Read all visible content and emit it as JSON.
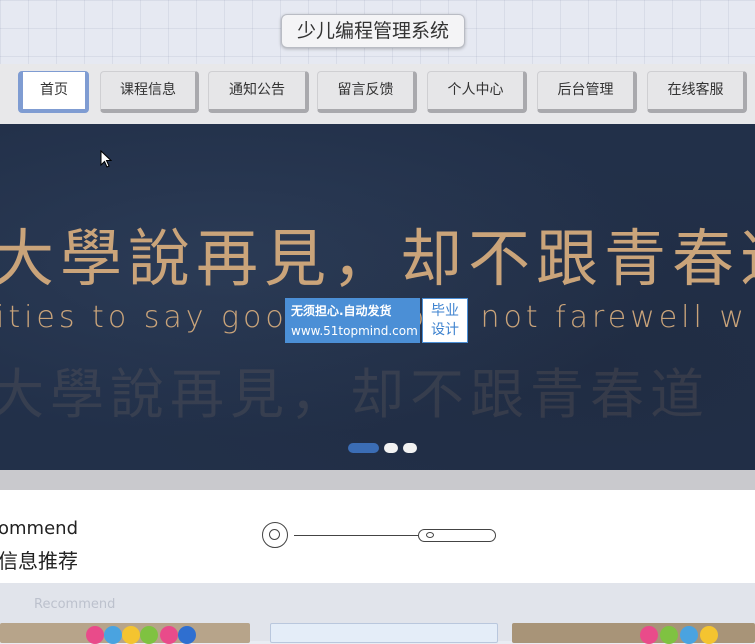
{
  "header": {
    "title": "少儿编程管理系统"
  },
  "nav": {
    "items": [
      {
        "label": "首页",
        "active": true
      },
      {
        "label": "课程信息",
        "active": false
      },
      {
        "label": "通知公告",
        "active": false
      },
      {
        "label": "留言反馈",
        "active": false
      },
      {
        "label": "个人中心",
        "active": false
      },
      {
        "label": "后台管理",
        "active": false
      },
      {
        "label": "在线客服",
        "active": false
      }
    ]
  },
  "banner": {
    "line_cn": "大學說再見，却不跟青春道",
    "line_en": "ities to say goodbye, but not farewell w",
    "carousel_dots": 3,
    "active_dot": 0
  },
  "ad": {
    "line1": "无须担心.自动发货",
    "line2": "www.51topmind.com",
    "badge_line1": "毕业",
    "badge_line2": "设计"
  },
  "recommend": {
    "title_en": "ommend",
    "title_cn": "信息推荐",
    "ghost_en": "Recommend"
  },
  "colors": {
    "nav_active": "#7f9cd2",
    "banner_bg": "#223049",
    "banner_text": "#caa47a",
    "ad_blue": "#4b8fd6"
  }
}
